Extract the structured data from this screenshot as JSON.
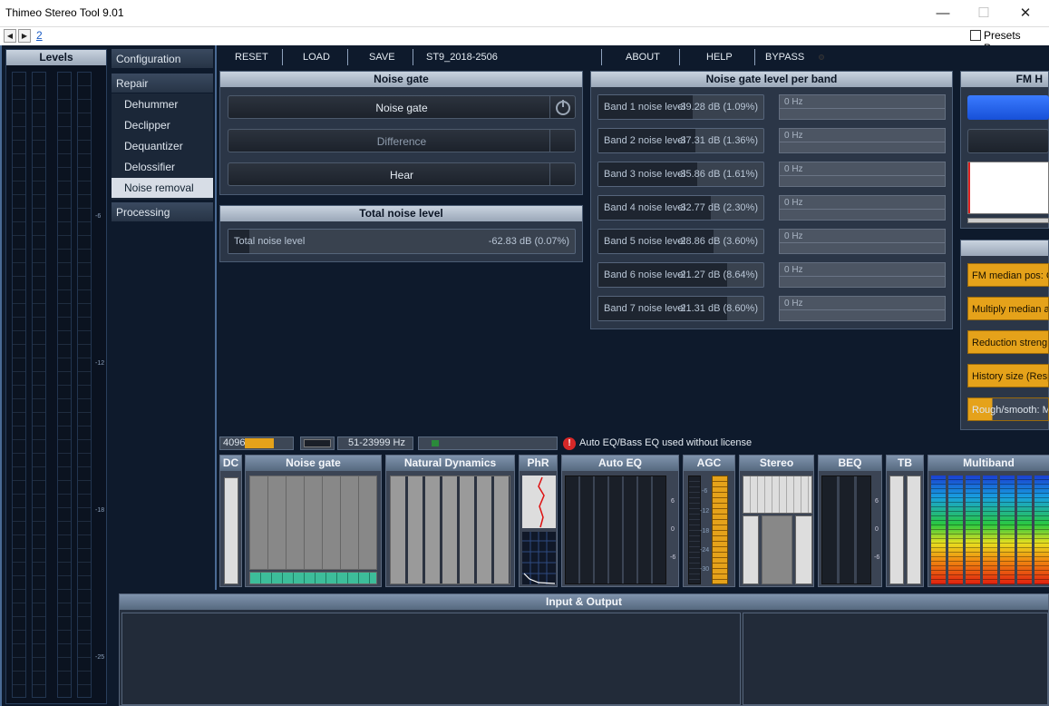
{
  "window": {
    "title": "Thimeo Stereo Tool 9.01",
    "minimize": "—",
    "maximize": "☐",
    "close": "✕"
  },
  "nav": {
    "back": "◀",
    "forward": "▶",
    "link": "2",
    "presets_label": "Presets Pane"
  },
  "levels": {
    "title": "Levels",
    "scale": [
      "-6",
      "-12",
      "-18",
      "-25"
    ]
  },
  "sidebar": {
    "configuration": "Configuration",
    "repair": "Repair",
    "items": [
      "Dehummer",
      "Declipper",
      "Dequantizer",
      "Delossifier",
      "Noise removal"
    ],
    "processing": "Processing"
  },
  "toolbar": {
    "reset": "RESET",
    "load": "LOAD",
    "save": "SAVE",
    "preset": "ST9_2018-2506",
    "about": "ABOUT",
    "help": "HELP",
    "bypass": "BYPASS"
  },
  "noise_gate": {
    "title": "Noise gate",
    "buttons": [
      "Noise gate",
      "Difference",
      "Hear"
    ]
  },
  "total_noise": {
    "title": "Total noise level",
    "label": "Total noise level",
    "value": "-62.83 dB (0.07%)",
    "fill": 0.06
  },
  "band_panel": {
    "title": "Noise gate level per band",
    "bands": [
      {
        "label": "Band 1 noise level",
        "value": "-39.28 dB (1.09%)",
        "hz": "0 Hz",
        "fill": 0.57
      },
      {
        "label": "Band 2 noise level",
        "value": "-37.31 dB (1.36%)",
        "hz": "0 Hz",
        "fill": 0.59
      },
      {
        "label": "Band 3 noise level",
        "value": "-35.86 dB (1.61%)",
        "hz": "0 Hz",
        "fill": 0.6
      },
      {
        "label": "Band 4 noise level",
        "value": "-32.77 dB (2.30%)",
        "hz": "0 Hz",
        "fill": 0.68
      },
      {
        "label": "Band 5 noise level",
        "value": "-28.86 dB (3.60%)",
        "hz": "0 Hz",
        "fill": 0.7
      },
      {
        "label": "Band 6 noise level",
        "value": "-21.27 dB (8.64%)",
        "hz": "0 Hz",
        "fill": 0.78
      },
      {
        "label": "Band 7 noise level",
        "value": "-21.31 dB (8.60%)",
        "hz": "0 Hz",
        "fill": 0.78
      }
    ]
  },
  "fm_panel": {
    "title": "FM H"
  },
  "orange_buttons": [
    "FM median pos: C",
    "Multiply median a",
    "Reduction streng",
    "History size (Resp",
    "Rough/smooth: M"
  ],
  "status": {
    "blocksize": "4096",
    "freq": "51-23999 Hz",
    "warning": "Auto EQ/Bass EQ used without license",
    "warning_icon": "!"
  },
  "modules": [
    "DC",
    "Noise gate",
    "Natural Dynamics",
    "PhR",
    "Auto EQ",
    "AGC",
    "Stereo",
    "BEQ",
    "TB",
    "Multiband"
  ],
  "agc_scale": [
    "-6",
    "-12",
    "-18",
    "-24",
    "-30"
  ],
  "eq_scale": [
    "6",
    "0",
    "-6"
  ],
  "io": {
    "title": "Input & Output"
  },
  "colors": {
    "accent_orange": "#e5a21a",
    "background": "#0e1a2c",
    "warning_red": "#d62828"
  }
}
